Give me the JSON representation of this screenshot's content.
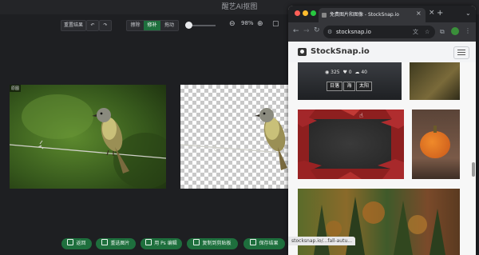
{
  "app": {
    "title": "醒艺AI抠图",
    "toolbar": {
      "reset_label": "重置结果",
      "undo_icon": "undo-icon",
      "redo_icon": "redo-icon",
      "modes": [
        "擦除",
        "修补",
        "拖动"
      ],
      "active_mode": "修补",
      "zoom_level": "98%"
    },
    "original_tag": "原图",
    "buttons": [
      "返回",
      "重选图片",
      "用 Ps 编辑",
      "复制到剪贴板",
      "保存结果"
    ]
  },
  "browser": {
    "tab_title": "免费图片和图像 - StockSnap.io",
    "url": "stocksnap.io",
    "site_name": "StockSnap.io",
    "photo_stats": {
      "views": "325",
      "likes": "0",
      "downloads": "40"
    },
    "photo_tags": [
      "日落",
      "海",
      "太阳"
    ],
    "status_url": "stocksnap.io/...fall-autu..."
  },
  "colors": {
    "accent_green": "#1e6f3d",
    "app_bg": "#1e1f22",
    "browser_bg": "#f7f7f7"
  }
}
